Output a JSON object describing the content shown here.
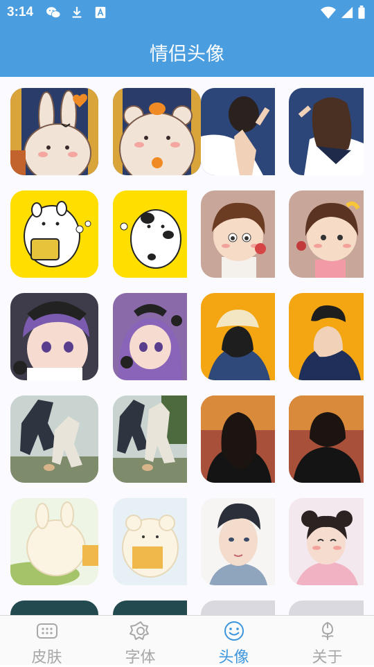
{
  "status_bar": {
    "time": "3:14"
  },
  "app_bar": {
    "title": "情侣头像"
  },
  "avatar_grid": {
    "rows": [
      [
        "bunny-avatar",
        "bear-avatar",
        "boy-back-avatar",
        "girl-back-avatar"
      ],
      [
        "white-dog-avatar",
        "spotted-cat-avatar",
        "cartoon-boy-avatar",
        "cartoon-girl-avatar"
      ],
      [
        "kuromi-boy-avatar",
        "kuromi-girl-avatar",
        "bucket-hat-avatar",
        "hoodie-boy-avatar"
      ],
      [
        "photo-couple-left-avatar",
        "photo-couple-right-avatar",
        "sunset-girl-avatar",
        "sunset-boy-avatar"
      ],
      [
        "fluffy-bunny-avatar",
        "bear-book-avatar",
        "anime-boy-avatar",
        "anime-girl-avatar"
      ]
    ]
  },
  "bottom_nav": {
    "tabs": [
      {
        "label": "皮肤",
        "icon": "grid-icon",
        "active": false
      },
      {
        "label": "字体",
        "icon": "flower-gear-icon",
        "active": false
      },
      {
        "label": "头像",
        "icon": "smiley-icon",
        "active": true
      },
      {
        "label": "关于",
        "icon": "tulip-icon",
        "active": false
      }
    ]
  },
  "colors": {
    "primary": "#4a9ddf",
    "tab_active": "#3c95dc",
    "tab_inactive": "#a7a7a7"
  }
}
